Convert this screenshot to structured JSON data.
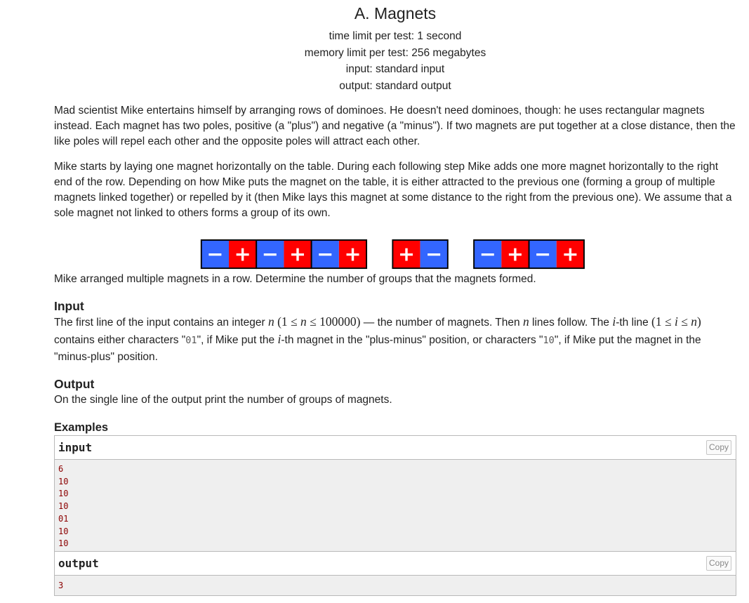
{
  "problem": {
    "title": "A. Magnets",
    "limits": [
      "time limit per test: 1 second",
      "memory limit per test: 256 megabytes",
      "input: standard input",
      "output: standard output"
    ],
    "paragraphs": [
      "Mad scientist Mike entertains himself by arranging rows of dominoes. He doesn't need dominoes, though: he uses rectangular magnets instead. Each magnet has two poles, positive (a \"plus\") and negative (a \"minus\"). If two magnets are put together at a close distance, then the like poles will repel each other and the opposite poles will attract each other.",
      "Mike starts by laying one magnet horizontally on the table. During each following step Mike adds one more magnet horizontally to the right end of the row. Depending on how Mike puts the magnet on the table, it is either attracted to the previous one (forming a group of multiple magnets linked together) or repelled by it (then Mike lays this magnet at some distance to the right from the previous one). We assume that a sole magnet not linked to others forms a group of its own."
    ],
    "caption": "Mike arranged multiple magnets in a row. Determine the number of groups that the magnets formed.",
    "input_section": {
      "title": "Input",
      "text_1": "The first line of the input contains an integer ",
      "math_n": "n",
      "math_range_1": "(1 ≤ ",
      "math_range_2": " ≤ 100000)",
      "text_2": " — the number of magnets. Then ",
      "text_3": " lines follow. The ",
      "math_i": "i",
      "text_4": "-th line ",
      "math_irange_1": "(1 ≤ ",
      "math_irange_2": " ≤ ",
      "math_irange_3": ")",
      "text_5": " contains either characters \"",
      "code_01": "01",
      "text_6": "\", if Mike put the ",
      "text_7": "-th magnet in the \"plus-minus\" position, or characters \"",
      "code_10": "10",
      "text_8": "\", if Mike put the magnet in the \"minus-plus\" position."
    },
    "output_section": {
      "title": "Output",
      "text": "On the single line of the output print the number of groups of magnets."
    },
    "examples": {
      "title": "Examples",
      "input_label": "input",
      "output_label": "output",
      "copy_label": "Copy",
      "input_lines": [
        "6",
        "10",
        "10",
        "10",
        "01",
        "10",
        "10"
      ],
      "output_lines": [
        "3"
      ]
    }
  },
  "figure": {
    "groups": [
      [
        "-+",
        "-+",
        "-+"
      ],
      [
        "+-"
      ],
      [
        "-+",
        "-+"
      ]
    ],
    "plus_symbol": "+",
    "minus_symbol": "−",
    "colors": {
      "plus": "#ff0000",
      "minus": "#3366ff",
      "border": "#000000",
      "symbol": "#ffffff"
    }
  }
}
